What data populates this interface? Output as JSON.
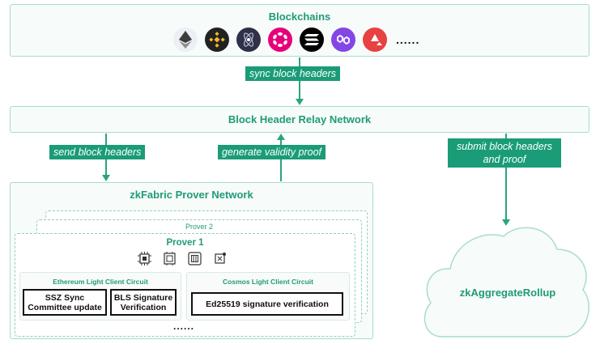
{
  "blockchains": {
    "title": "Blockchains",
    "logos": [
      "ethereum-logo",
      "bnb-chain-logo",
      "cosmos-logo",
      "polkadot-logo",
      "solana-logo",
      "polygon-logo",
      "avalanche-logo"
    ],
    "more": "......"
  },
  "edges": {
    "sync": "sync block headers",
    "send": "send block headers",
    "generate": "generate validity proof",
    "submit_line1": "submit block headers",
    "submit_line2": "and proof"
  },
  "relay": {
    "title": "Block Header Relay Network"
  },
  "prover_network": {
    "title": "zkFabric Prover Network",
    "prover2": "Prover 2",
    "prover1": {
      "title": "Prover 1",
      "hardware_icons": [
        "cpu-icon",
        "gpu-icon",
        "fpga-icon",
        "asic-icon"
      ],
      "ethereum_circuit": {
        "title": "Ethereum Light Client Circuit",
        "box1_line1": "SSZ Sync",
        "box1_line2": "Committee update",
        "box2_line1": "BLS Signature",
        "box2_line2": "Verification"
      },
      "cosmos_circuit": {
        "title": "Cosmos Light Client Circuit",
        "box1": "Ed25519 signature verification"
      },
      "more": "......"
    }
  },
  "rollup": {
    "title": "zkAggregateRollup"
  },
  "colors": {
    "accent": "#1f9b78",
    "border": "#a9ddc9",
    "fill": "#f7fbf9"
  }
}
